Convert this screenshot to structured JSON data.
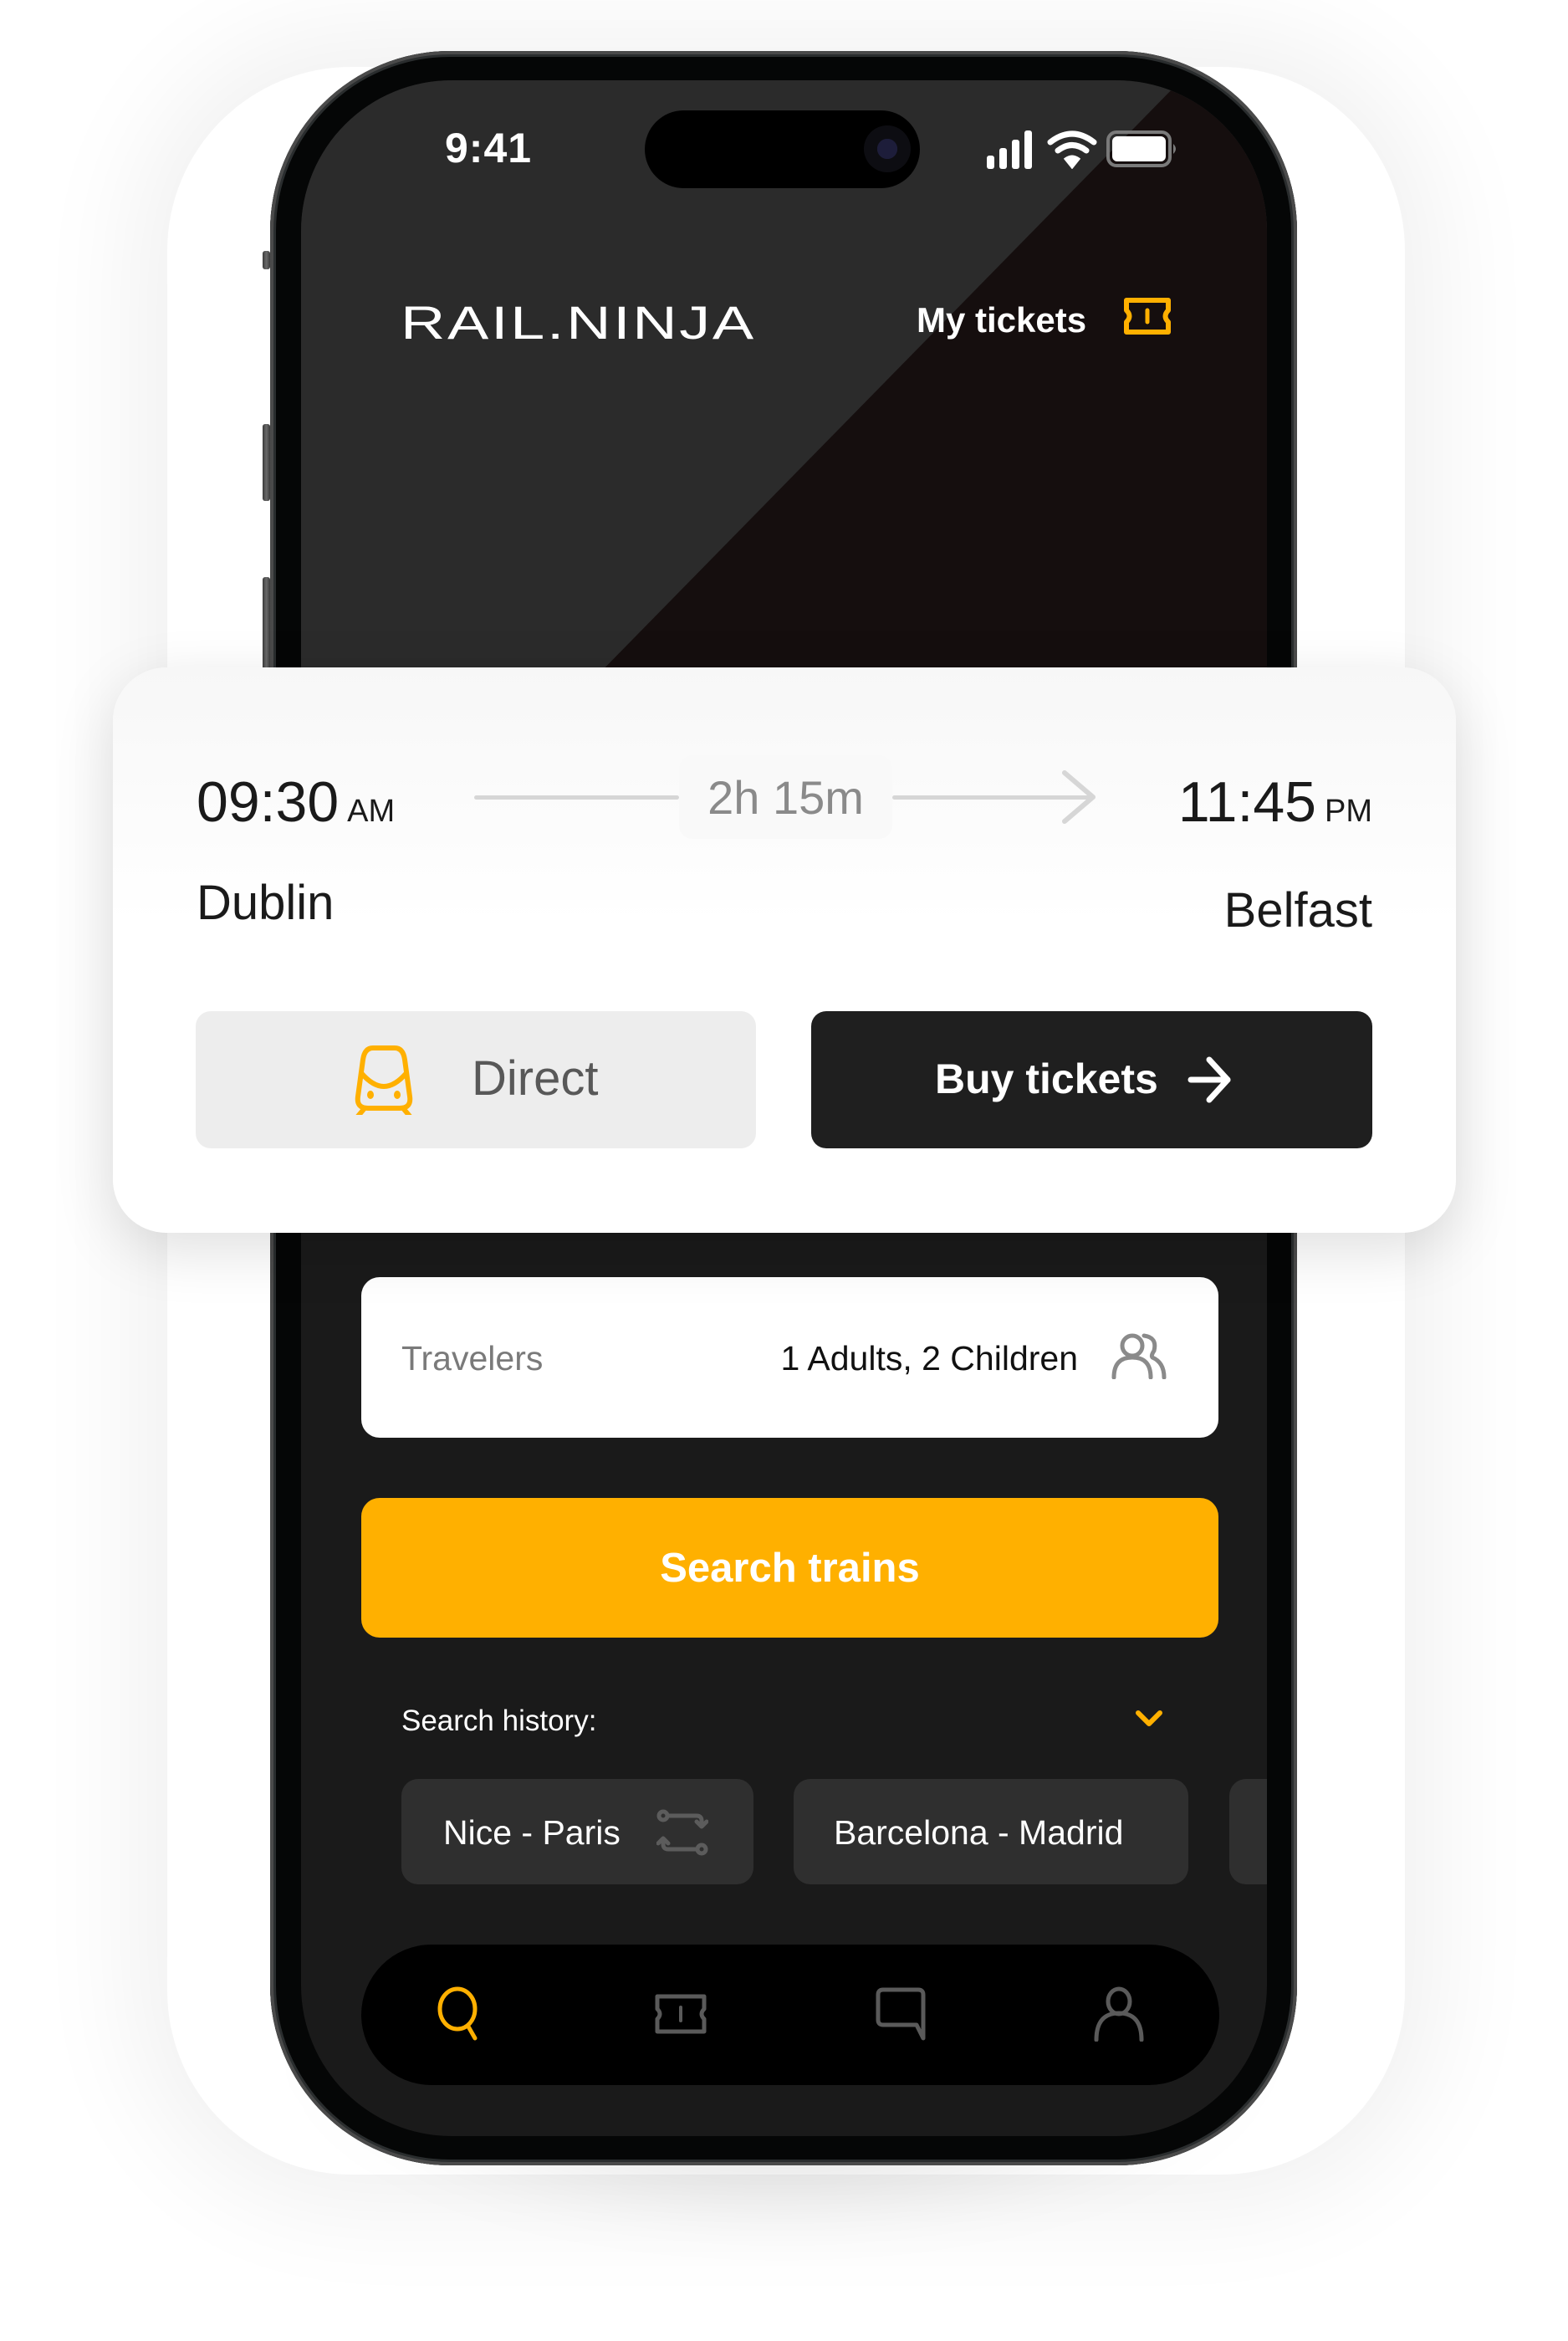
{
  "status_bar": {
    "time": "9:41",
    "icons": [
      "cellular-signal-icon",
      "wifi-icon",
      "battery-icon"
    ]
  },
  "header": {
    "logo": "RAIL.NINJA",
    "my_tickets_label": "My tickets",
    "my_tickets_icon": "ticket-icon"
  },
  "trip_card": {
    "departure": {
      "time": "09:30",
      "period": "AM",
      "city": "Dublin"
    },
    "arrival": {
      "time": "11:45",
      "period": "PM",
      "city": "Belfast"
    },
    "duration": "2h 15m",
    "direct_label": "Direct",
    "direct_icon": "train-icon",
    "buy_label": "Buy tickets",
    "buy_icon": "arrow-right-icon"
  },
  "travelers": {
    "label": "Travelers",
    "value": "1 Adults, 2 Children",
    "icon": "people-icon"
  },
  "search_button_label": "Search trains",
  "search_history": {
    "label": "Search history:",
    "toggle_icon": "chevron-down-icon",
    "items": [
      {
        "label": "Nice - Paris",
        "icon": "swap-icon"
      },
      {
        "label": "Barcelona - Madrid"
      },
      {
        "label": ""
      }
    ]
  },
  "bottom_nav": {
    "items": [
      {
        "name": "search",
        "icon": "search-icon",
        "active": true
      },
      {
        "name": "tickets",
        "icon": "ticket-icon",
        "active": false
      },
      {
        "name": "messages",
        "icon": "chat-icon",
        "active": false
      },
      {
        "name": "profile",
        "icon": "user-icon",
        "active": false
      }
    ]
  },
  "colors": {
    "accent": "#FFB000",
    "screen_bg": "#1A1A1A",
    "header_bg_light": "#2B2B2B",
    "header_bg_dark": "#150E0E",
    "buy_button_bg": "#1F1F1F",
    "direct_button_bg": "#EDEDED",
    "chip_bg": "#2F2F2F",
    "inactive_icon": "#5A5A5A"
  }
}
